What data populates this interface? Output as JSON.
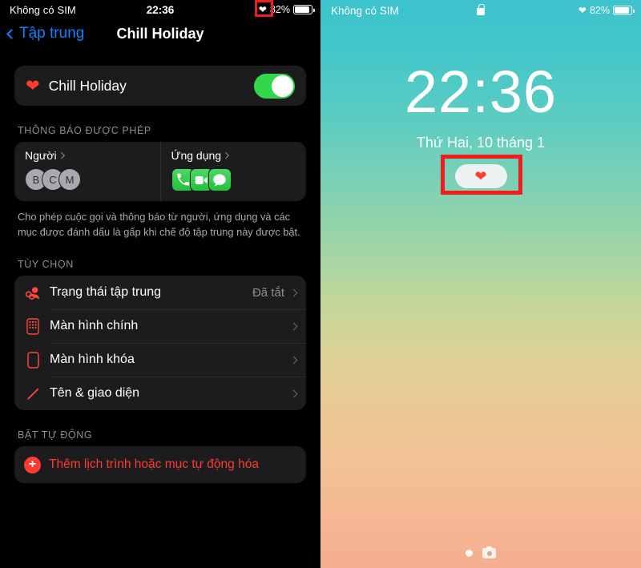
{
  "settings_panel": {
    "statusbar": {
      "carrier": "Không có SIM",
      "time": "22:36",
      "focus_icon": "heart-icon",
      "battery_percent": "82%",
      "battery_level": 82
    },
    "navbar": {
      "back_label": "Tập trung",
      "title": "Chill Holiday"
    },
    "focus_card": {
      "icon": "heart-icon",
      "name": "Chill Holiday",
      "toggle_on": true,
      "toggle_color": "#32d74b"
    },
    "allowed_section": {
      "header": "THÔNG BÁO ĐƯỢC PHÉP",
      "people": {
        "title": "Người",
        "avatars": [
          "B",
          "C",
          "M"
        ]
      },
      "apps": {
        "title": "Ứng dụng",
        "icons": [
          "phone-icon",
          "facetime-icon",
          "messages-icon"
        ]
      },
      "description": "Cho phép cuộc gọi và thông báo từ người, ứng dụng và các mục được đánh dấu là gấp khi chế độ tập trung này được bật."
    },
    "options_section": {
      "header": "TÙY CHỌN",
      "rows": [
        {
          "icon": "focus-status-icon",
          "label": "Trạng thái tập trung",
          "value": "Đã tắt"
        },
        {
          "icon": "home-screen-icon",
          "label": "Màn hình chính",
          "value": ""
        },
        {
          "icon": "lock-screen-icon",
          "label": "Màn hình khóa",
          "value": ""
        },
        {
          "icon": "pencil-icon",
          "label": "Tên & giao diện",
          "value": ""
        }
      ]
    },
    "automation_section": {
      "header": "BẬT TỰ ĐỘNG",
      "add_icon": "plus-circle-icon",
      "add_label": "Thêm lịch trình hoặc mục tự động hóa",
      "accent_color": "#ff3b30"
    }
  },
  "lock_screen": {
    "statusbar": {
      "carrier": "Không có SIM",
      "lock_icon": "lock-icon",
      "focus_icon": "heart-icon",
      "battery_percent": "82%",
      "battery_level": 82
    },
    "clock": "22:36",
    "date": "Thứ Hai, 10 tháng 1",
    "focus_pill": {
      "icon": "heart-icon",
      "color": "#ff3b30"
    },
    "bottom": {
      "page_dot": "page-indicator-dot",
      "camera_icon": "camera-icon"
    },
    "wallpaper_top_color": "#3dc3cd",
    "wallpaper_bottom_color": "#f3ae8d"
  },
  "annotations": {
    "highlight_color": "#f21c1c",
    "boxes": [
      "status-bar-focus-heart",
      "lock-screen-focus-pill"
    ]
  }
}
